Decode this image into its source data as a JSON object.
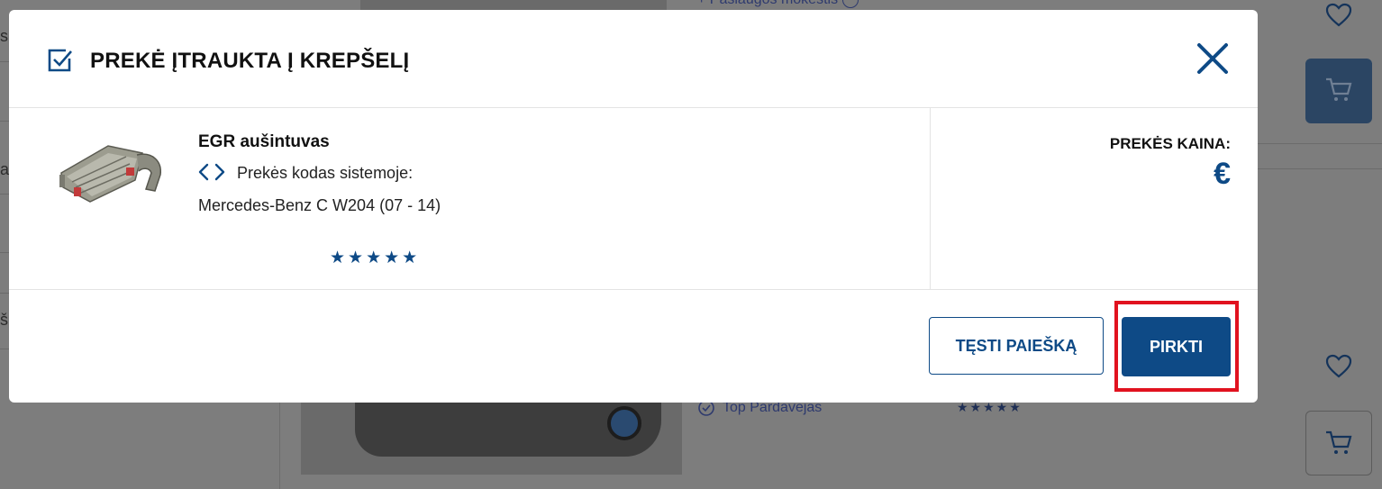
{
  "background": {
    "top_text": "+ Paslaugos mokestis",
    "seller_text": "Top Pardavejas",
    "stars": "★★★★★",
    "left_chars": [
      "s",
      "a,",
      "š"
    ]
  },
  "modal": {
    "title": "PREKĖ ĮTRAUKTA Į KREPŠELĮ",
    "product": {
      "name": "EGR aušintuvas",
      "code_label": "Prekės kodas sistemoje:",
      "model": "Mercedes-Benz C W204 (07 - 14)",
      "stars": "★★★★★",
      "rating": 5
    },
    "price": {
      "label": "PREKĖS KAINA:",
      "value": "€"
    },
    "buttons": {
      "continue": "TĘSTI PAIEŠKĄ",
      "buy": "PIRKTI"
    }
  },
  "colors": {
    "accent": "#0e4a86",
    "highlight": "#e1121f",
    "overlay": "#7d7d7d"
  },
  "icons": [
    "checkbox-checked-icon",
    "close-icon",
    "code-icon",
    "heart-icon",
    "cart-icon",
    "info-icon",
    "verified-badge-icon"
  ]
}
